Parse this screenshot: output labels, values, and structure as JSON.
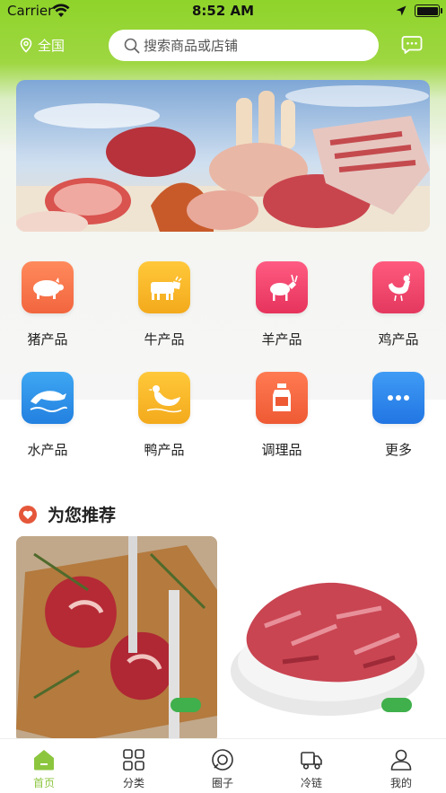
{
  "status_bar": {
    "carrier": "Carrier",
    "time": "8:52 AM"
  },
  "nav": {
    "location": "全国",
    "search_placeholder": "搜索商品或店铺"
  },
  "categories": [
    {
      "label": "猪产品",
      "icon": "pig-icon",
      "color": "#f47a4e"
    },
    {
      "label": "牛产品",
      "icon": "cow-icon",
      "color": "#f6b92b"
    },
    {
      "label": "羊产品",
      "icon": "goat-icon",
      "color": "#ef3e6a"
    },
    {
      "label": "鸡产品",
      "icon": "chicken-icon",
      "color": "#f0436c"
    },
    {
      "label": "水产品",
      "icon": "dolphin-icon",
      "color": "#2f97ea"
    },
    {
      "label": "鸭产品",
      "icon": "duck-icon",
      "color": "#f6b92b"
    },
    {
      "label": "调理品",
      "icon": "bottle-icon",
      "color": "#f46b45"
    },
    {
      "label": "更多",
      "icon": "more-icon",
      "color": "#2f8ef0"
    }
  ],
  "recommend": {
    "title": "为您推荐"
  },
  "tabbar": [
    {
      "label": "首页",
      "icon": "home-icon",
      "active": true
    },
    {
      "label": "分类",
      "icon": "grid-icon",
      "active": false
    },
    {
      "label": "圈子",
      "icon": "chat-circle-icon",
      "active": false
    },
    {
      "label": "冷链",
      "icon": "truck-icon",
      "active": false
    },
    {
      "label": "我的",
      "icon": "user-icon",
      "active": false
    }
  ],
  "colors": {
    "brand_green": "#8cc63f",
    "header_green": "#8fd42a"
  }
}
